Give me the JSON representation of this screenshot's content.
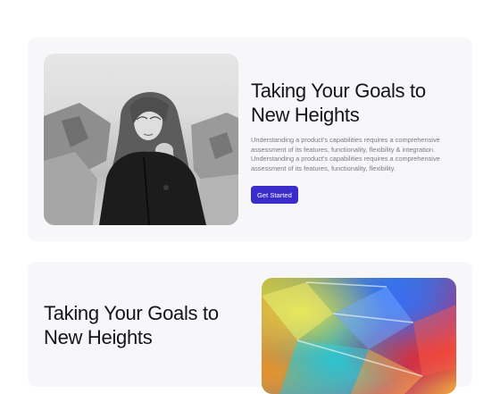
{
  "sections": [
    {
      "title": "Taking Your Goals to New Heights",
      "description": "Understanding a product's capabilities requires a comprehensive assessment of its features, functionality, flexibility & integration. Understanding a product's capabilities requires a comprehensive assessment of its features, functionality, flexibility.",
      "button_label": "Get Started"
    },
    {
      "title": "Taking Your Goals to New Heights"
    }
  ],
  "colors": {
    "card_background": "#f7f7fa",
    "button": "#3a2dcc",
    "title_text": "#151518",
    "body_text": "#7a7a82"
  }
}
